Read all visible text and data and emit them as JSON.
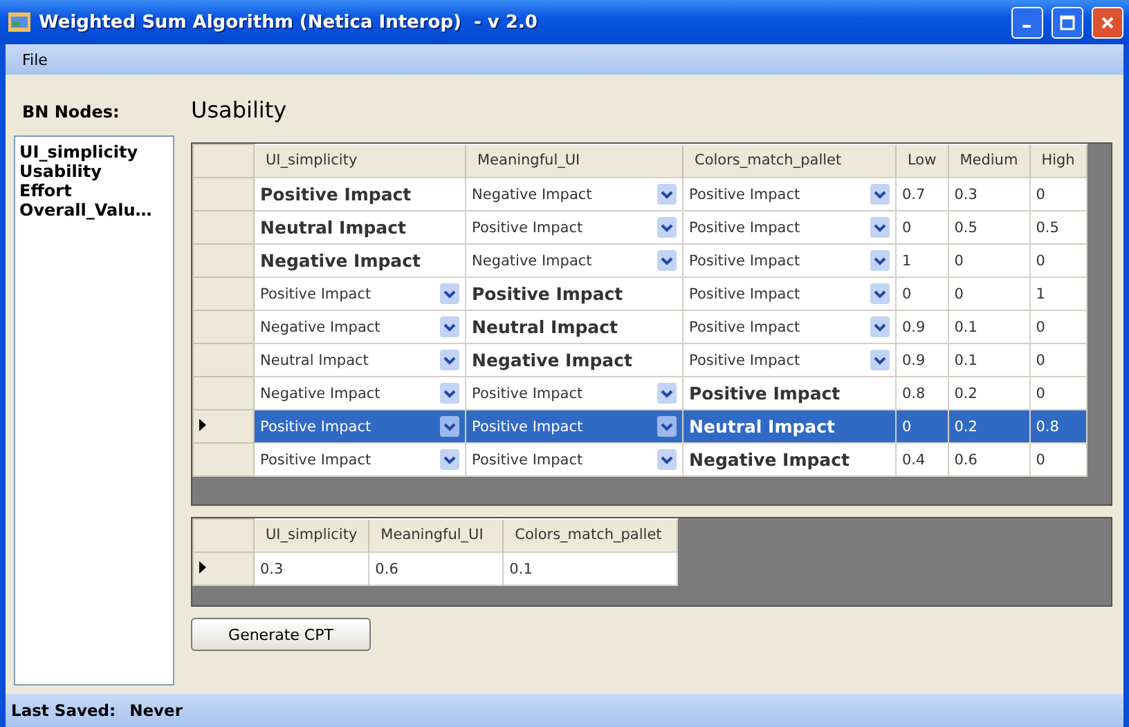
{
  "window": {
    "title": "Weighted Sum Algorithm (Netica Interop)  - v 2.0"
  },
  "menu": [
    "File"
  ],
  "nodes_label": "BN Nodes:",
  "nodes": [
    "UI_simplicity",
    "Usability",
    "Effort",
    "Overall_Valu…"
  ],
  "node_title": "Usability",
  "cpt_table": {
    "columns": [
      "UI_simplicity",
      "Meaningful_UI",
      "Colors_match_pallet",
      "Low",
      "Medium",
      "High"
    ],
    "rows": [
      {
        "selected": false,
        "current": false,
        "cells": [
          {
            "kind": "fixed",
            "text": "Positive Impact"
          },
          {
            "kind": "select",
            "text": "Negative Impact"
          },
          {
            "kind": "select",
            "text": "Positive Impact"
          }
        ],
        "values": [
          "0.7",
          "0.3",
          "0"
        ]
      },
      {
        "selected": false,
        "current": false,
        "cells": [
          {
            "kind": "fixed",
            "text": "Neutral Impact"
          },
          {
            "kind": "select",
            "text": "Positive Impact"
          },
          {
            "kind": "select",
            "text": "Positive Impact"
          }
        ],
        "values": [
          "0",
          "0.5",
          "0.5"
        ]
      },
      {
        "selected": false,
        "current": false,
        "cells": [
          {
            "kind": "fixed",
            "text": "Negative Impact"
          },
          {
            "kind": "select",
            "text": "Negative Impact"
          },
          {
            "kind": "select",
            "text": "Positive Impact"
          }
        ],
        "values": [
          "1",
          "0",
          "0"
        ]
      },
      {
        "selected": false,
        "current": false,
        "cells": [
          {
            "kind": "select",
            "text": "Positive Impact"
          },
          {
            "kind": "fixed",
            "text": "Positive Impact"
          },
          {
            "kind": "select",
            "text": "Positive Impact"
          }
        ],
        "values": [
          "0",
          "0",
          "1"
        ]
      },
      {
        "selected": false,
        "current": false,
        "cells": [
          {
            "kind": "select",
            "text": "Negative Impact"
          },
          {
            "kind": "fixed",
            "text": "Neutral Impact"
          },
          {
            "kind": "select",
            "text": "Positive Impact"
          }
        ],
        "values": [
          "0.9",
          "0.1",
          "0"
        ]
      },
      {
        "selected": false,
        "current": false,
        "cells": [
          {
            "kind": "select",
            "text": "Neutral Impact"
          },
          {
            "kind": "fixed",
            "text": "Negative Impact"
          },
          {
            "kind": "select",
            "text": "Positive Impact"
          }
        ],
        "values": [
          "0.9",
          "0.1",
          "0"
        ]
      },
      {
        "selected": false,
        "current": false,
        "cells": [
          {
            "kind": "select",
            "text": "Negative Impact"
          },
          {
            "kind": "select",
            "text": "Positive Impact"
          },
          {
            "kind": "fixed",
            "text": "Positive Impact"
          }
        ],
        "values": [
          "0.8",
          "0.2",
          "0"
        ]
      },
      {
        "selected": true,
        "current": true,
        "cells": [
          {
            "kind": "select",
            "text": "Positive Impact"
          },
          {
            "kind": "select",
            "text": "Positive Impact"
          },
          {
            "kind": "fixed",
            "text": "Neutral Impact"
          }
        ],
        "values": [
          "0",
          "0.2",
          "0.8"
        ]
      },
      {
        "selected": false,
        "current": false,
        "cells": [
          {
            "kind": "select",
            "text": "Positive Impact"
          },
          {
            "kind": "select",
            "text": "Positive Impact"
          },
          {
            "kind": "fixed",
            "text": "Negative Impact"
          }
        ],
        "values": [
          "0.4",
          "0.6",
          "0"
        ]
      }
    ]
  },
  "weights_table": {
    "columns": [
      "UI_simplicity",
      "Meaningful_UI",
      "Colors_match_pallet"
    ],
    "rows": [
      {
        "current": true,
        "values": [
          "0.3",
          "0.6",
          "0.1"
        ]
      }
    ]
  },
  "generate_button": "Generate CPT",
  "status_bar": {
    "label": "Last Saved:",
    "value": "Never"
  }
}
